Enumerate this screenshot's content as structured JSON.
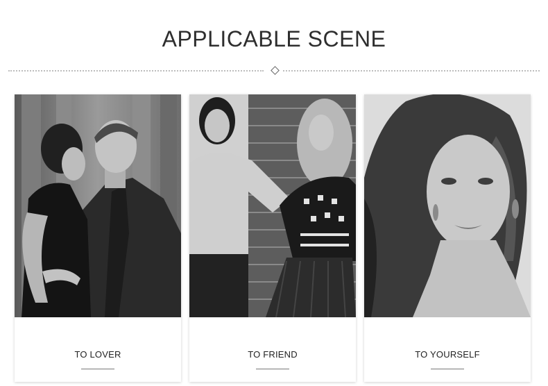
{
  "page": {
    "title": "APPLICABLE SCENE"
  },
  "cards": [
    {
      "label": "TO LOVER",
      "image": "couple-photo"
    },
    {
      "label": "TO FRIEND",
      "image": "friends-photo"
    },
    {
      "label": "TO YOURSELF",
      "image": "woman-portrait-photo"
    }
  ],
  "colors": {
    "title": "#2e2e2e",
    "divider": "#bdbdbd",
    "card_bg": "#ffffff"
  }
}
